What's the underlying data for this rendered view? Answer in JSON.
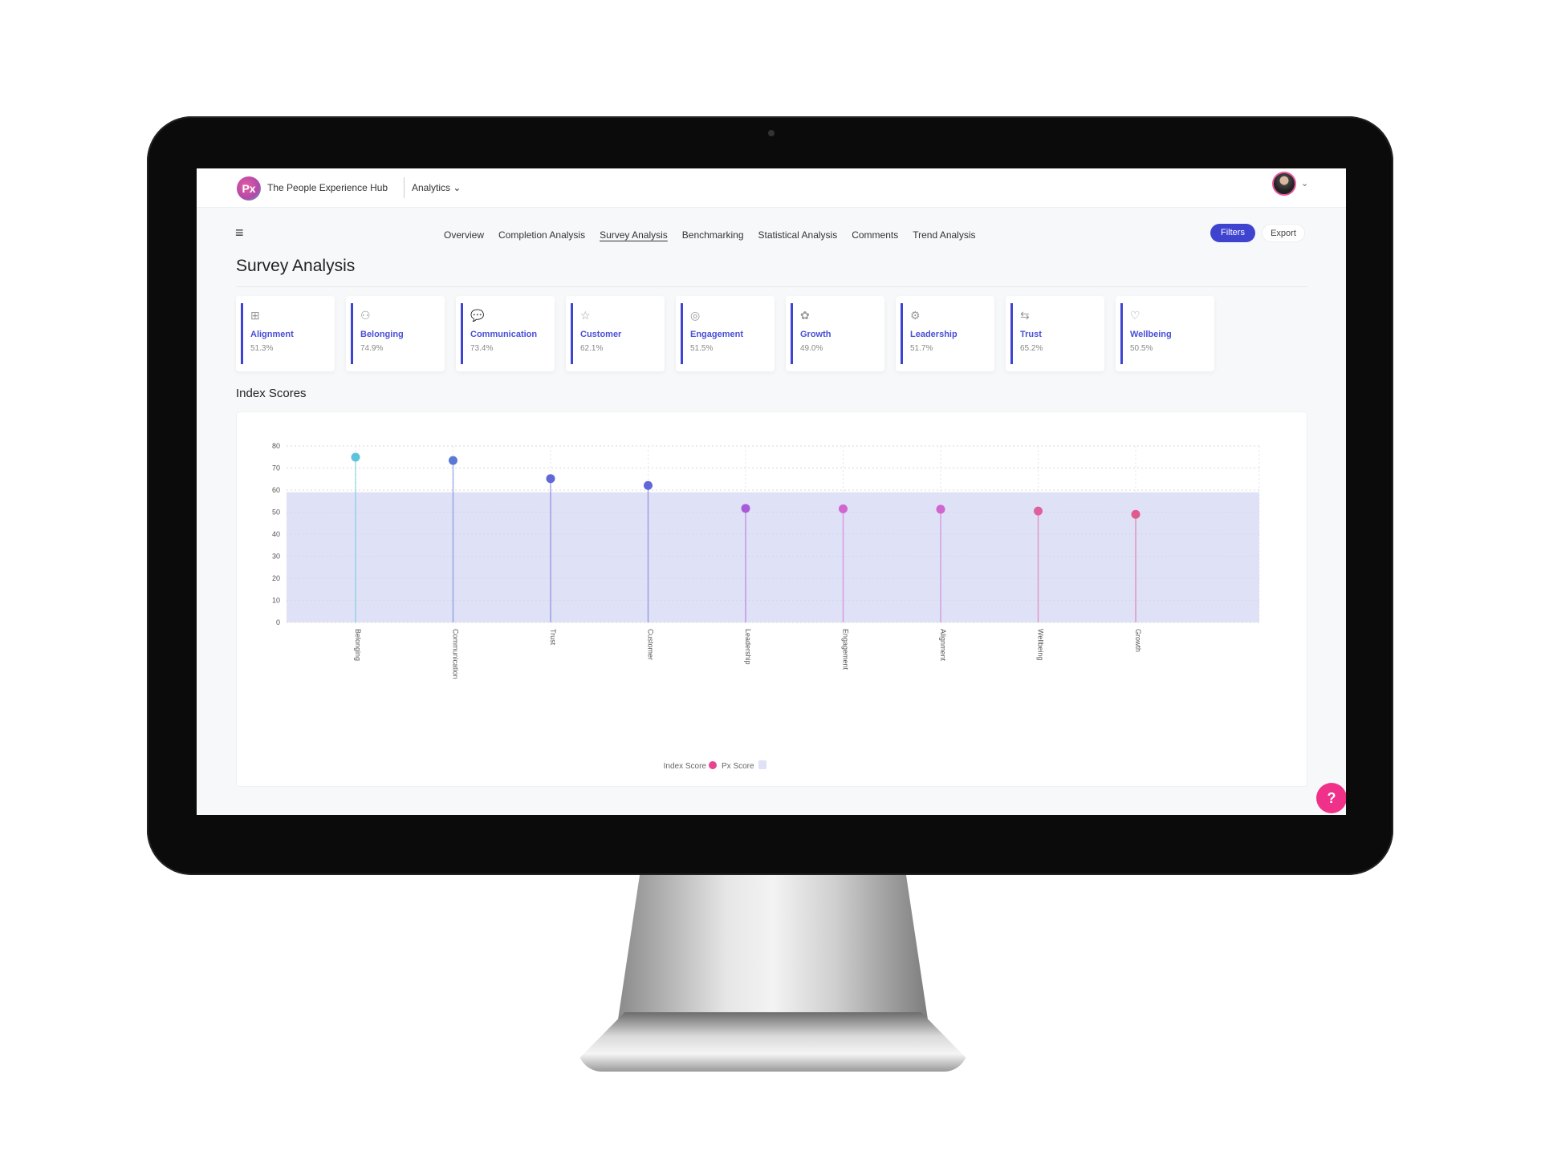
{
  "header": {
    "brand": "The People Experience Hub",
    "logo_text": "Px",
    "section": "Analytics",
    "section_icon": "chevron-down-icon"
  },
  "nav": {
    "tabs": [
      {
        "label": "Overview"
      },
      {
        "label": "Completion Analysis"
      },
      {
        "label": "Survey Analysis",
        "active": true
      },
      {
        "label": "Benchmarking"
      },
      {
        "label": "Statistical Analysis"
      },
      {
        "label": "Comments"
      },
      {
        "label": "Trend Analysis"
      }
    ],
    "filters_label": "Filters",
    "export_label": "Export",
    "menu_icon": "hamburger-icon"
  },
  "page": {
    "title": "Survey Analysis",
    "section_title": "Index Scores",
    "help_label": "?"
  },
  "colors": {
    "accent": "#3f44d0",
    "help": "#f0318a",
    "band": "#dfe1f6"
  },
  "cards": [
    {
      "name": "Alignment",
      "value": "51.3%",
      "icon": "⊞"
    },
    {
      "name": "Belonging",
      "value": "74.9%",
      "icon": "⚇"
    },
    {
      "name": "Communication",
      "value": "73.4%",
      "icon": "💬"
    },
    {
      "name": "Customer",
      "value": "62.1%",
      "icon": "☆"
    },
    {
      "name": "Engagement",
      "value": "51.5%",
      "icon": "◎"
    },
    {
      "name": "Growth",
      "value": "49.0%",
      "icon": "✿"
    },
    {
      "name": "Leadership",
      "value": "51.7%",
      "icon": "⚙"
    },
    {
      "name": "Trust",
      "value": "65.2%",
      "icon": "⇆"
    },
    {
      "name": "Wellbeing",
      "value": "50.5%",
      "icon": "♡"
    }
  ],
  "chart_data": {
    "type": "lollipop",
    "categories": [
      "Belonging",
      "Communication",
      "Trust",
      "Customer",
      "Leadership",
      "Engagement",
      "Alignment",
      "Wellbeing",
      "Growth"
    ],
    "series": [
      {
        "name": "Index Score",
        "values": [
          74.9,
          73.4,
          65.2,
          62.1,
          51.7,
          51.5,
          51.3,
          50.5,
          49.0
        ]
      },
      {
        "name": "Px Score",
        "values": [
          59
        ]
      }
    ],
    "point_colors": [
      "#5cc3dc",
      "#5a78d8",
      "#6068d8",
      "#6068d8",
      "#a85ad8",
      "#d066d0",
      "#d066d0",
      "#e0609e",
      "#e05a8e"
    ],
    "yticks": [
      0,
      10,
      20,
      30,
      40,
      50,
      60,
      70,
      80
    ],
    "ylim": [
      0,
      80
    ],
    "grid": true,
    "legend": "bottom"
  }
}
